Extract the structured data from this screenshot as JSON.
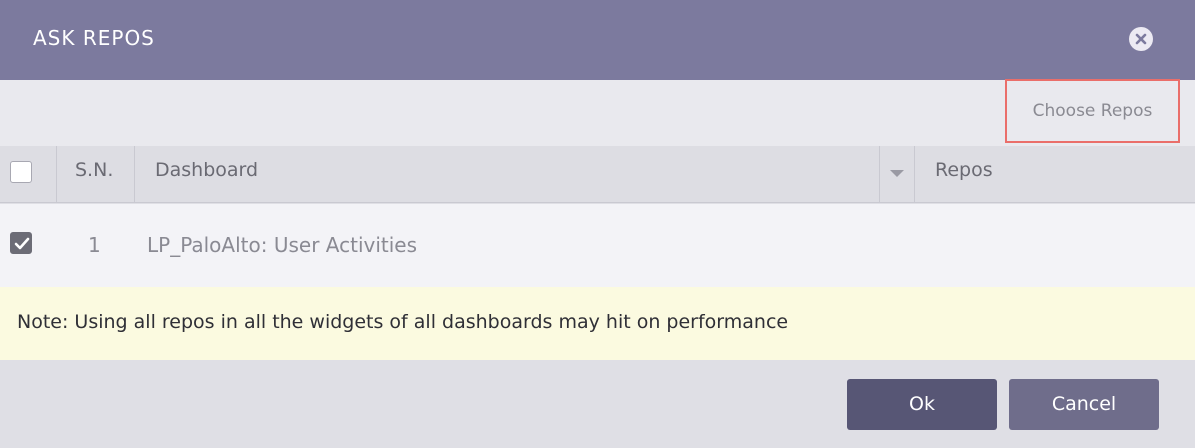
{
  "dialog": {
    "title": "ASK REPOS",
    "close_icon": "close-icon",
    "accent_color": "#7c7a9e"
  },
  "toolbar": {
    "choose_repos_label": "Choose Repos"
  },
  "table": {
    "columns": [
      "S.N.",
      "Dashboard",
      "Repos"
    ],
    "header_checkbox_checked": false,
    "rows": [
      {
        "checked": true,
        "sn": "1",
        "dashboard": "LP_PaloAlto: User Activities",
        "repos": ""
      }
    ]
  },
  "note": {
    "text": "Note: Using all repos in all the widgets of all dashboards may hit on performance"
  },
  "footer": {
    "ok_label": "Ok",
    "cancel_label": "Cancel"
  }
}
